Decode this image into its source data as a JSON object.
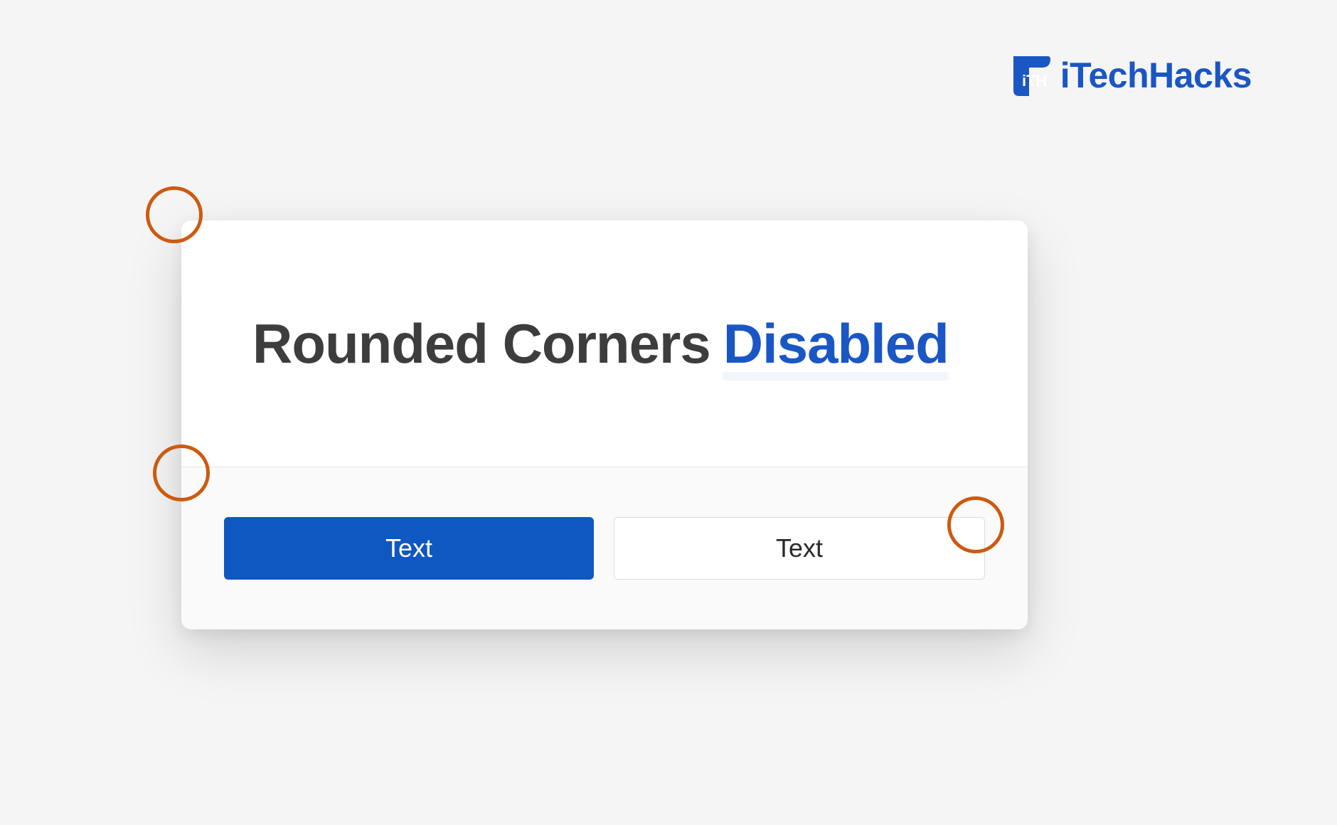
{
  "watermark": {
    "brand": "iTechHacks",
    "logo_label": "iTH"
  },
  "card": {
    "title_prefix": "Rounded Corners",
    "title_status": "Disabled"
  },
  "buttons": {
    "primary_label": "Text",
    "secondary_label": "Text"
  },
  "colors": {
    "accent_blue": "#1a56c4",
    "button_blue": "#0f57c1",
    "annotation_orange": "#cc5a10",
    "title_dark": "#3d3d3d"
  }
}
